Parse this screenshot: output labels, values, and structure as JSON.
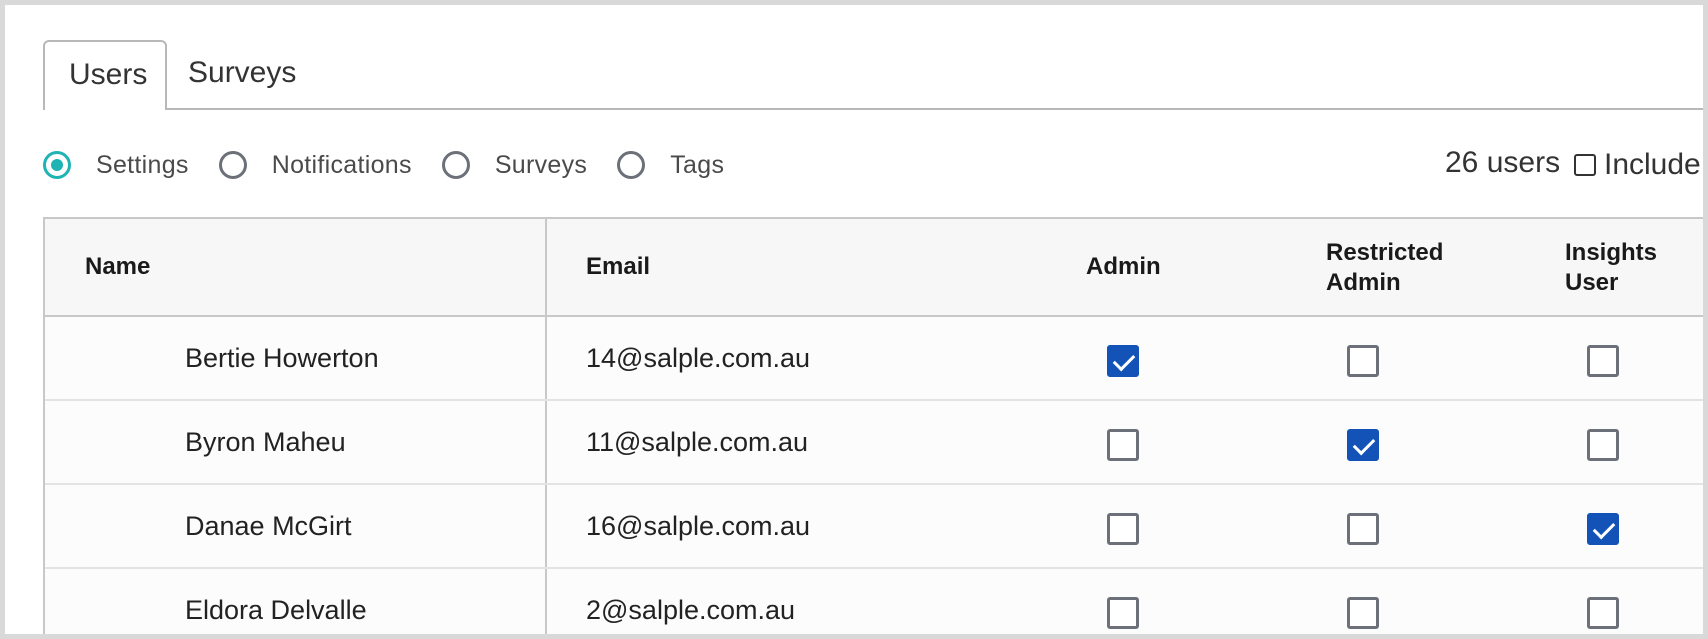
{
  "tabs": [
    {
      "label": "Users",
      "active": true
    },
    {
      "label": "Surveys",
      "active": false
    }
  ],
  "filters": {
    "options": [
      {
        "label": "Settings",
        "selected": true
      },
      {
        "label": "Notifications",
        "selected": false
      },
      {
        "label": "Surveys",
        "selected": false
      },
      {
        "label": "Tags",
        "selected": false
      }
    ],
    "user_count": "26 users",
    "include_label": "Include"
  },
  "table": {
    "headers": {
      "name": "Name",
      "email": "Email",
      "admin": "Admin",
      "restricted_admin_line1": "Restricted",
      "restricted_admin_line2": "Admin",
      "insights_line1": "Insights",
      "insights_line2": "User"
    },
    "rows": [
      {
        "name": "Bertie Howerton",
        "email": "14@salple.com.au",
        "admin": true,
        "restricted_admin": false,
        "insights_user": false
      },
      {
        "name": "Byron Maheu",
        "email": "11@salple.com.au",
        "admin": false,
        "restricted_admin": true,
        "insights_user": false
      },
      {
        "name": "Danae McGirt",
        "email": "16@salple.com.au",
        "admin": false,
        "restricted_admin": false,
        "insights_user": true
      },
      {
        "name": "Eldora Delvalle",
        "email": "2@salple.com.au",
        "admin": false,
        "restricted_admin": false,
        "insights_user": false
      }
    ]
  },
  "colors": {
    "radio_accent": "#1fb3b3",
    "checkbox_checked": "#1353b8"
  }
}
